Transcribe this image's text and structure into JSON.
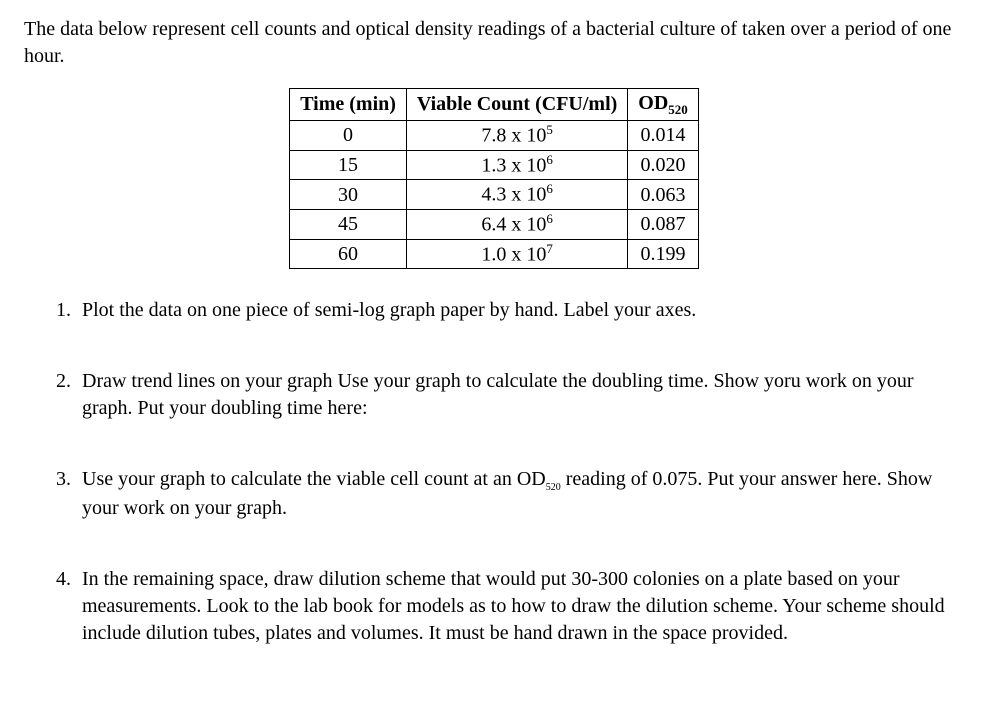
{
  "intro": "The data below represent cell counts and optical density readings of a bacterial culture of taken over a period of one hour.",
  "table": {
    "headers": {
      "time": "Time (min)",
      "count": "Viable Count (CFU/ml)",
      "od_prefix": "OD",
      "od_sub": "520"
    },
    "rows": [
      {
        "time": "0",
        "count_base": "7.8 x 10",
        "count_exp": "5",
        "od": "0.014"
      },
      {
        "time": "15",
        "count_base": "1.3 x 10",
        "count_exp": "6",
        "od": "0.020"
      },
      {
        "time": "30",
        "count_base": "4.3 x 10",
        "count_exp": "6",
        "od": "0.063"
      },
      {
        "time": "45",
        "count_base": "6.4 x 10",
        "count_exp": "6",
        "od": "0.087"
      },
      {
        "time": "60",
        "count_base": "1.0 x 10",
        "count_exp": "7",
        "od": "0.199"
      }
    ]
  },
  "questions": {
    "q1": "Plot the data on one piece of semi-log graph paper by hand. Label your axes.",
    "q2": "Draw trend lines on your graph Use your graph to calculate the doubling time. Show yoru work on your graph. Put your doubling time here:",
    "q3_a": "Use your graph to calculate the viable cell count at an OD",
    "q3_sub": "520",
    "q3_b": " reading of 0.075. Put your answer here. Show your work on your graph.",
    "q4": "In the remaining space, draw dilution scheme that would put 30-300 colonies on a plate based on your measurements. Look to the lab book for models as to how to draw the dilution scheme. Your scheme should include dilution tubes, plates and volumes. It must be hand drawn in the space provided."
  }
}
